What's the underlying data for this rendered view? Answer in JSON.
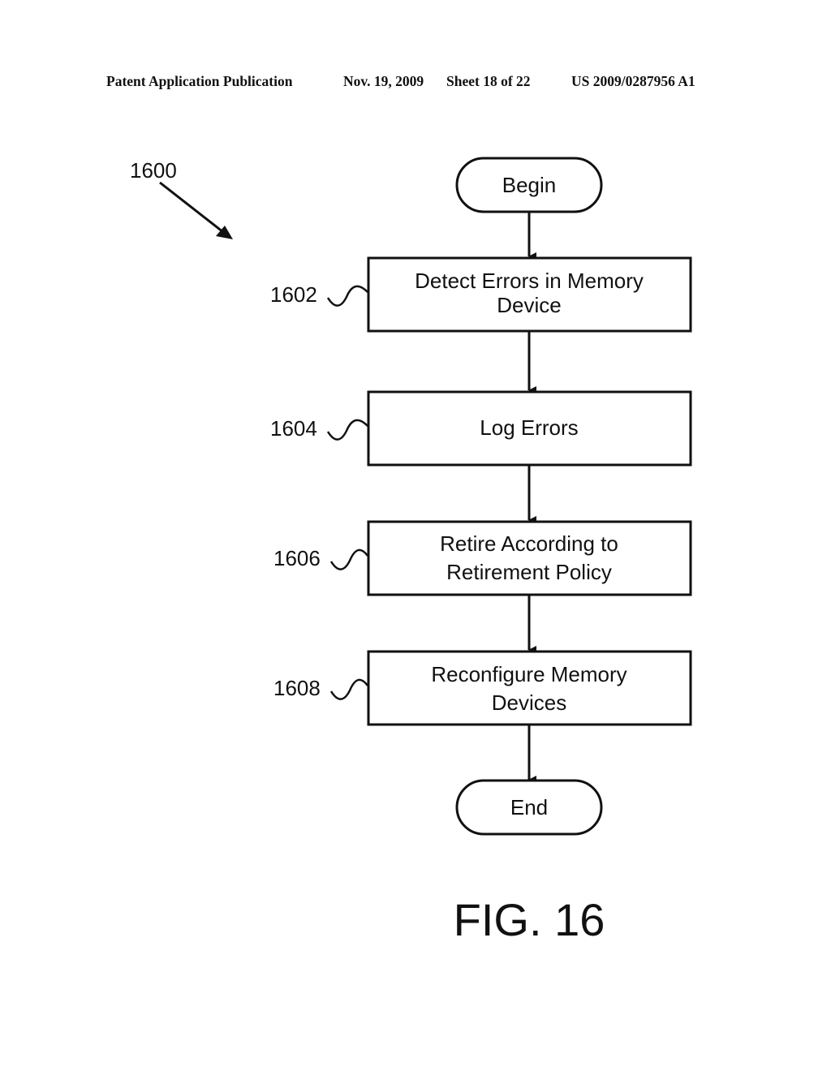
{
  "header": {
    "publication": "Patent Application Publication",
    "date": "Nov. 19, 2009",
    "sheet": "Sheet 18 of 22",
    "number": "US 2009/0287956 A1"
  },
  "figure": {
    "reference": "1600",
    "caption": "FIG. 16",
    "terminals": {
      "begin": "Begin",
      "end": "End"
    },
    "steps": [
      {
        "ref": "1602",
        "lines": [
          "Detect Errors in Memory",
          "Device"
        ]
      },
      {
        "ref": "1604",
        "lines": [
          "Log Errors"
        ]
      },
      {
        "ref": "1606",
        "lines": [
          "Retire According to",
          "Retirement Policy"
        ]
      },
      {
        "ref": "1608",
        "lines": [
          "Reconfigure Memory",
          "Devices"
        ]
      }
    ]
  }
}
